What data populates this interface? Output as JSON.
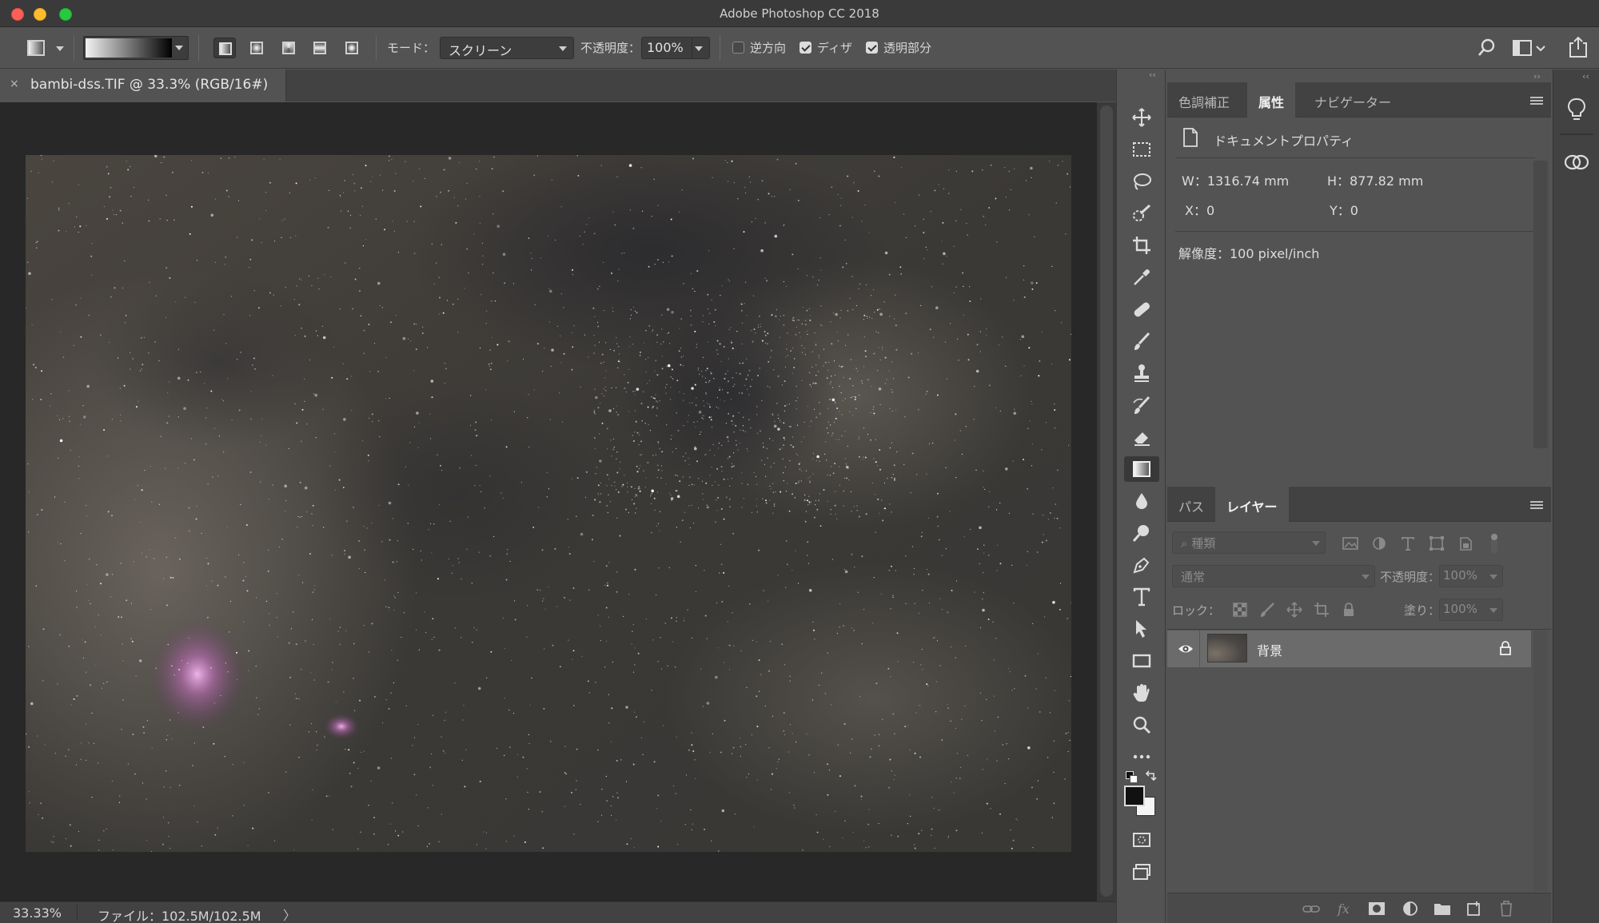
{
  "app": {
    "title": "Adobe Photoshop CC 2018"
  },
  "options_bar": {
    "mode_label": "モード：",
    "mode_value": "スクリーン",
    "opacity_label": "不透明度：",
    "opacity_value": "100%",
    "reverse_label": "逆方向",
    "reverse_checked": false,
    "dither_label": "ディザ",
    "dither_checked": true,
    "transparency_label": "透明部分",
    "transparency_checked": true,
    "gradient_types": [
      "linear",
      "radial",
      "angle",
      "reflected",
      "diamond"
    ],
    "active_gradient_type": "linear"
  },
  "document": {
    "tab_title": "bambi-dss.TIF @ 33.3% (RGB/16#)",
    "close_glyph": "×"
  },
  "status": {
    "zoom": "33.33%",
    "file_info": "ファイル：102.5M/102.5M",
    "arrow": "〉"
  },
  "toolbar": {
    "collapse_glyph": "‹‹",
    "tools": [
      "move",
      "marquee",
      "lasso",
      "quick-select",
      "crop",
      "eyedropper",
      "healing",
      "brush",
      "stamp",
      "history-brush",
      "eraser",
      "gradient",
      "blur",
      "dodge",
      "pen",
      "type",
      "path-select",
      "rectangle",
      "hand",
      "zoom",
      "more",
      "color-swap",
      "color-swatches",
      "quick-mask",
      "screen-mode"
    ],
    "active_tool": "gradient"
  },
  "properties_panel": {
    "tabs": [
      "色調補正",
      "属性",
      "ナビゲーター"
    ],
    "active_tab": "属性",
    "section_title": "ドキュメントプロパティ",
    "w": "W：1316.74 mm",
    "h": "H：877.82 mm",
    "x": "X：0",
    "y": "Y：0",
    "resolution": "解像度：100 pixel/inch"
  },
  "layers_panel": {
    "tabs": [
      "パス",
      "レイヤー"
    ],
    "active_tab": "レイヤー",
    "filter_placeholder": "種類",
    "blend_mode": "通常",
    "opacity_label": "不透明度：",
    "opacity_value": "100%",
    "lock_label": "ロック：",
    "fill_label": "塗り：",
    "fill_value": "100%",
    "layers": [
      {
        "name": "背景",
        "visible": true,
        "locked": true
      }
    ],
    "footer_icons": [
      "link-icon",
      "fx-icon",
      "mask-icon",
      "adjustment-icon",
      "folder-icon",
      "new-layer-icon",
      "trash-icon"
    ]
  },
  "right_strip": {
    "collapse_glyph": "‹‹",
    "buttons": [
      "learn-icon",
      "libraries-icon"
    ]
  },
  "colors": {
    "ui_bg": "#535353",
    "panel_header": "#424242",
    "canvas_bg": "#282828",
    "image_base": "#3d3a37"
  }
}
